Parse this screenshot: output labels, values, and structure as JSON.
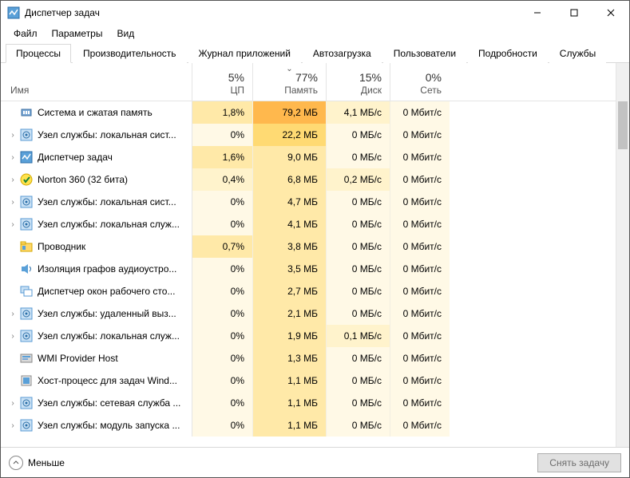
{
  "window": {
    "title": "Диспетчер задач"
  },
  "menu": {
    "file": "Файл",
    "options": "Параметры",
    "view": "Вид"
  },
  "tabs": {
    "processes": "Процессы",
    "performance": "Производительность",
    "app_history": "Журнал приложений",
    "startup": "Автозагрузка",
    "users": "Пользователи",
    "details": "Подробности",
    "services": "Службы"
  },
  "columns": {
    "name": "Имя",
    "cpu_pct": "5%",
    "cpu_label": "ЦП",
    "mem_pct": "77%",
    "mem_label": "Память",
    "disk_pct": "15%",
    "disk_label": "Диск",
    "net_pct": "0%",
    "net_label": "Сеть"
  },
  "rows": [
    {
      "exp": false,
      "icon": "memory",
      "name": "Система и сжатая память",
      "cpu": "1,8%",
      "cpu_h": 2,
      "mem": "79,2 МБ",
      "mem_h": 4,
      "disk": "4,1 МБ/с",
      "disk_h": 1,
      "net": "0 Мбит/с",
      "net_h": 0
    },
    {
      "exp": true,
      "icon": "svc",
      "name": "Узел службы: локальная сист...",
      "cpu": "0%",
      "cpu_h": 0,
      "mem": "22,2 МБ",
      "mem_h": 3,
      "disk": "0 МБ/с",
      "disk_h": 0,
      "net": "0 Мбит/с",
      "net_h": 0
    },
    {
      "exp": true,
      "icon": "taskmgr",
      "name": "Диспетчер задач",
      "cpu": "1,6%",
      "cpu_h": 2,
      "mem": "9,0 МБ",
      "mem_h": 2,
      "disk": "0 МБ/с",
      "disk_h": 0,
      "net": "0 Мбит/с",
      "net_h": 0
    },
    {
      "exp": true,
      "icon": "norton",
      "name": "Norton 360 (32 бита)",
      "cpu": "0,4%",
      "cpu_h": 1,
      "mem": "6,8 МБ",
      "mem_h": 2,
      "disk": "0,2 МБ/с",
      "disk_h": 1,
      "net": "0 Мбит/с",
      "net_h": 0
    },
    {
      "exp": true,
      "icon": "svc",
      "name": "Узел службы: локальная сист...",
      "cpu": "0%",
      "cpu_h": 0,
      "mem": "4,7 МБ",
      "mem_h": 2,
      "disk": "0 МБ/с",
      "disk_h": 0,
      "net": "0 Мбит/с",
      "net_h": 0
    },
    {
      "exp": true,
      "icon": "svc",
      "name": "Узел службы: локальная служ...",
      "cpu": "0%",
      "cpu_h": 0,
      "mem": "4,1 МБ",
      "mem_h": 2,
      "disk": "0 МБ/с",
      "disk_h": 0,
      "net": "0 Мбит/с",
      "net_h": 0
    },
    {
      "exp": false,
      "icon": "explorer",
      "name": "Проводник",
      "cpu": "0,7%",
      "cpu_h": 2,
      "mem": "3,8 МБ",
      "mem_h": 2,
      "disk": "0 МБ/с",
      "disk_h": 0,
      "net": "0 Мбит/с",
      "net_h": 0
    },
    {
      "exp": false,
      "icon": "audio",
      "name": "Изоляция графов аудиоустро...",
      "cpu": "0%",
      "cpu_h": 0,
      "mem": "3,5 МБ",
      "mem_h": 2,
      "disk": "0 МБ/с",
      "disk_h": 0,
      "net": "0 Мбит/с",
      "net_h": 0
    },
    {
      "exp": false,
      "icon": "dwm",
      "name": "Диспетчер окон рабочего сто...",
      "cpu": "0%",
      "cpu_h": 0,
      "mem": "2,7 МБ",
      "mem_h": 2,
      "disk": "0 МБ/с",
      "disk_h": 0,
      "net": "0 Мбит/с",
      "net_h": 0
    },
    {
      "exp": true,
      "icon": "svc",
      "name": "Узел службы: удаленный выз...",
      "cpu": "0%",
      "cpu_h": 0,
      "mem": "2,1 МБ",
      "mem_h": 2,
      "disk": "0 МБ/с",
      "disk_h": 0,
      "net": "0 Мбит/с",
      "net_h": 0
    },
    {
      "exp": true,
      "icon": "svc",
      "name": "Узел службы: локальная служ...",
      "cpu": "0%",
      "cpu_h": 0,
      "mem": "1,9 МБ",
      "mem_h": 2,
      "disk": "0,1 МБ/с",
      "disk_h": 1,
      "net": "0 Мбит/с",
      "net_h": 0
    },
    {
      "exp": false,
      "icon": "wmi",
      "name": "WMI Provider Host",
      "cpu": "0%",
      "cpu_h": 0,
      "mem": "1,3 МБ",
      "mem_h": 2,
      "disk": "0 МБ/с",
      "disk_h": 0,
      "net": "0 Мбит/с",
      "net_h": 0
    },
    {
      "exp": false,
      "icon": "host",
      "name": "Хост-процесс для задач Wind...",
      "cpu": "0%",
      "cpu_h": 0,
      "mem": "1,1 МБ",
      "mem_h": 2,
      "disk": "0 МБ/с",
      "disk_h": 0,
      "net": "0 Мбит/с",
      "net_h": 0
    },
    {
      "exp": true,
      "icon": "svc",
      "name": "Узел службы: сетевая служба ...",
      "cpu": "0%",
      "cpu_h": 0,
      "mem": "1,1 МБ",
      "mem_h": 2,
      "disk": "0 МБ/с",
      "disk_h": 0,
      "net": "0 Мбит/с",
      "net_h": 0
    },
    {
      "exp": true,
      "icon": "svc",
      "name": "Узел службы: модуль запуска ...",
      "cpu": "0%",
      "cpu_h": 0,
      "mem": "1,1 МБ",
      "mem_h": 2,
      "disk": "0 МБ/с",
      "disk_h": 0,
      "net": "0 Мбит/с",
      "net_h": 0
    }
  ],
  "footer": {
    "fewer": "Меньше",
    "endtask": "Снять задачу"
  }
}
